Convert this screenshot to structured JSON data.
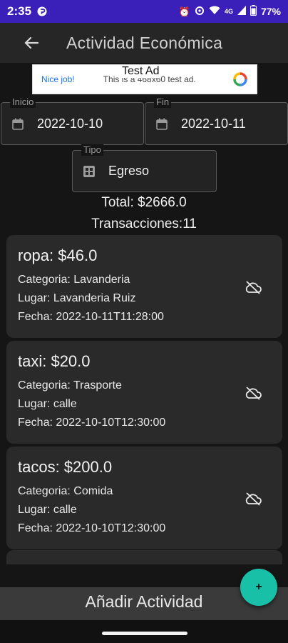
{
  "status_bar": {
    "time": "2:35",
    "network": "4G",
    "battery": "77%"
  },
  "app_bar": {
    "back_icon": "arrow-left-icon",
    "title": "Actividad Económica"
  },
  "ad": {
    "left_text": "Nice job!",
    "center_text": "This is a 468x60 test ad.",
    "tag": "Test Ad"
  },
  "filters": {
    "start": {
      "label": "Inicio",
      "value": "2022-10-10",
      "icon": "calendar-icon"
    },
    "end": {
      "label": "Fin",
      "value": "2022-10-11",
      "icon": "calendar-icon"
    },
    "type": {
      "label": "Tipo",
      "value": "Egreso",
      "icon": "grid-icon"
    }
  },
  "summary": {
    "total": "Total: $2666.0",
    "count": "Transacciones:11"
  },
  "transactions": [
    {
      "title": "ropa: $46.0",
      "category": "Categoria: Lavanderia",
      "place": "Lugar: Lavanderia Ruiz",
      "date": "Fecha: 2022-10-11T11:28:00",
      "action_icon": "cloud-off-icon"
    },
    {
      "title": "taxi: $20.0",
      "category": "Categoria: Trasporte",
      "place": "Lugar: calle",
      "date": "Fecha: 2022-10-10T12:30:00",
      "action_icon": "cloud-off-icon"
    },
    {
      "title": "tacos: $200.0",
      "category": "Categoria: Comida",
      "place": "Lugar: calle",
      "date": "Fecha: 2022-10-10T12:30:00",
      "action_icon": "cloud-off-icon"
    }
  ],
  "bottom": {
    "add_label": "Añadir Actividad",
    "fab_label": "+"
  },
  "colors": {
    "status_bar": "#3a1fb8",
    "accent_fab": "#19c0a8",
    "background": "#151515",
    "card": "#2a2a2a"
  }
}
